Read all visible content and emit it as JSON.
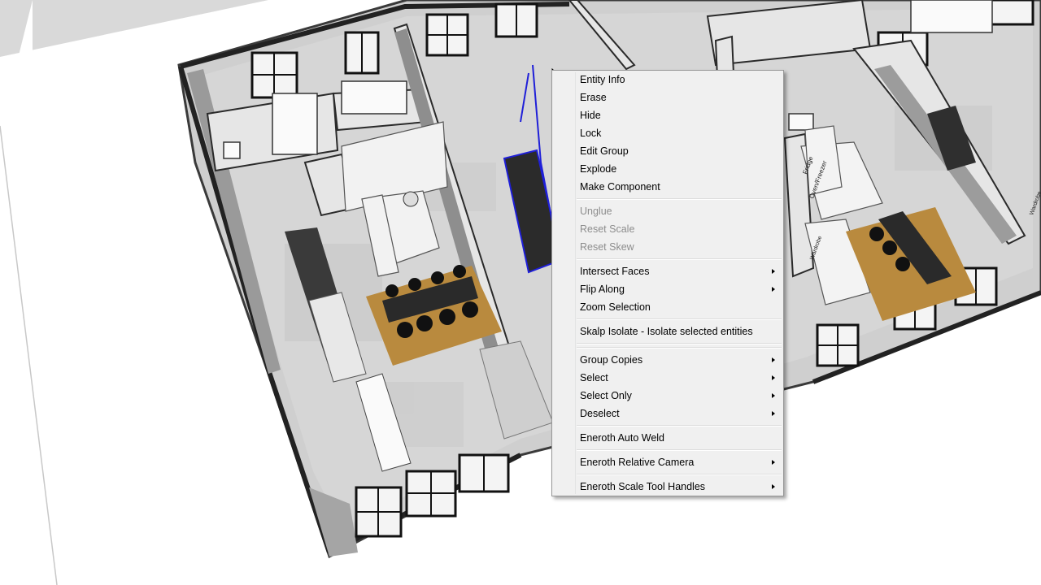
{
  "context_menu": {
    "groups": [
      [
        {
          "label": "Entity Info",
          "enabled": true,
          "submenu": false
        },
        {
          "label": "Erase",
          "enabled": true,
          "submenu": false
        },
        {
          "label": "Hide",
          "enabled": true,
          "submenu": false
        },
        {
          "label": "Lock",
          "enabled": true,
          "submenu": false
        },
        {
          "label": "Edit Group",
          "enabled": true,
          "submenu": false
        },
        {
          "label": "Explode",
          "enabled": true,
          "submenu": false
        },
        {
          "label": "Make Component",
          "enabled": true,
          "submenu": false
        }
      ],
      [
        {
          "label": "Unglue",
          "enabled": false,
          "submenu": false
        },
        {
          "label": "Reset Scale",
          "enabled": false,
          "submenu": false
        },
        {
          "label": "Reset Skew",
          "enabled": false,
          "submenu": false
        }
      ],
      [
        {
          "label": "Intersect Faces",
          "enabled": true,
          "submenu": true
        },
        {
          "label": "Flip Along",
          "enabled": true,
          "submenu": true
        },
        {
          "label": "Zoom Selection",
          "enabled": true,
          "submenu": false
        }
      ],
      [
        {
          "label": "Skalp Isolate - Isolate selected entities",
          "enabled": true,
          "submenu": false
        }
      ],
      [],
      [
        {
          "label": "Group Copies",
          "enabled": true,
          "submenu": true
        },
        {
          "label": "Select",
          "enabled": true,
          "submenu": true
        },
        {
          "label": "Select Only",
          "enabled": true,
          "submenu": true
        },
        {
          "label": "Deselect",
          "enabled": true,
          "submenu": true
        }
      ],
      [
        {
          "label": "Eneroth Auto Weld",
          "enabled": true,
          "submenu": false
        }
      ],
      [
        {
          "label": "Eneroth Relative Camera",
          "enabled": true,
          "submenu": true
        }
      ],
      [
        {
          "label": "Eneroth Scale Tool Handles",
          "enabled": true,
          "submenu": true
        }
      ]
    ]
  },
  "model_labels": {
    "wardrobe": "Wardrobe",
    "fridge": "Fridge",
    "oven_freezer": "Oven/Freezer"
  },
  "colors": {
    "wall": "#2b2b2b",
    "floor": "#d4d4d4",
    "rug": "#b98a3e",
    "selection": "#1f1fd8",
    "menu_bg": "#f0f0f0"
  }
}
